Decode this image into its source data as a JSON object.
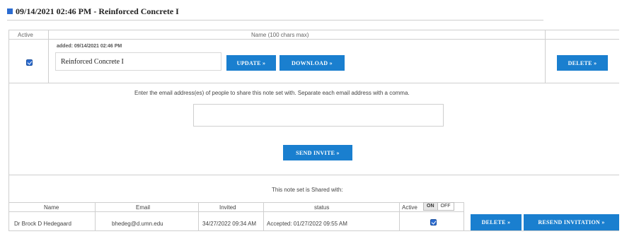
{
  "note": {
    "header_title": "09/14/2021 02:46 PM - Reinforced Concrete I",
    "table_headers": {
      "active": "Active",
      "name": "Name (100 chars max)"
    },
    "added_label": "added: 09/14/2021 02:46 PM",
    "name_value": "Reinforced Concrete I",
    "update_label": "UPDATE »",
    "download_label": "DOWNLOAD »",
    "delete_label": "DELETE »"
  },
  "share": {
    "instructions": "Enter the email address(es) of people to share this note set with. Separate each email address with a comma.",
    "email_value": "",
    "send_label": "SEND INVITE »",
    "shared_with_label": "This note set is Shared with:",
    "columns": {
      "name": "Name",
      "email": "Email",
      "invited": "Invited",
      "status": "status",
      "active": "Active"
    },
    "toggle": {
      "on": "ON",
      "off": "OFF"
    },
    "rows": [
      {
        "name": "Dr Brock D Hedegaard",
        "email": "bhedeg@d.umn.edu",
        "invited": "34/27/2022 09:34 AM",
        "status": "Accepted: 01/27/2022 09:55 AM",
        "delete_label": "DELETE »",
        "resend_label": "RESEND INVITATION »"
      }
    ]
  }
}
